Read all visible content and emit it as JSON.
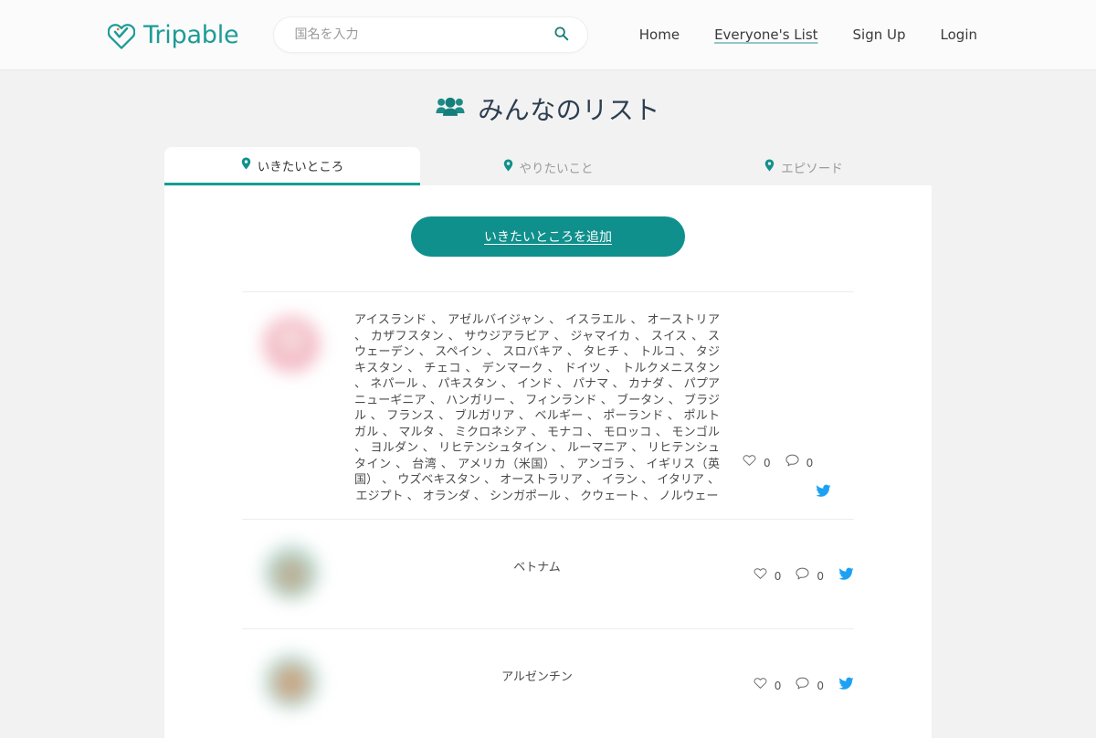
{
  "header": {
    "brand": "Tripable",
    "brand_icon": "heart-check-logo-icon",
    "search": {
      "placeholder": "国名を入力",
      "value": "",
      "icon": "search-icon"
    },
    "nav": [
      {
        "label": "Home",
        "active": false
      },
      {
        "label": "Everyone's List",
        "active": true
      },
      {
        "label": "Sign Up",
        "active": false
      },
      {
        "label": "Login",
        "active": false
      }
    ]
  },
  "page": {
    "title": "みんなのリスト",
    "title_icon": "users-group-icon"
  },
  "tabs": [
    {
      "label": "いきたいところ",
      "icon": "map-pin-icon",
      "active": true
    },
    {
      "label": "やりたいこと",
      "icon": "map-pin-icon",
      "active": false
    },
    {
      "label": "エピソード",
      "icon": "map-pin-icon",
      "active": false
    }
  ],
  "add_button": {
    "label": "いきたいところを追加"
  },
  "entries": [
    {
      "avatar": "blurred-pink-avatar",
      "text": "アイスランド 、 アゼルバイジャン 、 イスラエル 、 オーストリア 、 カザフスタン 、 サウジアラビア 、 ジャマイカ 、 スイス 、 スウェーデン 、 スペイン 、 スロバキア 、 タヒチ 、 トルコ 、 タジキスタン 、 チェコ 、 デンマーク 、 ドイツ 、 トルクメニスタン 、 ネパール 、 パキスタン 、 インド 、 パナマ 、 カナダ 、 パプアニューギニア 、 ハンガリー 、 フィンランド 、 ブータン 、 ブラジル 、 フランス 、 ブルガリア 、 ベルギー 、 ポーランド 、 ポルトガル 、 マルタ 、 ミクロネシア 、 モナコ 、 モロッコ 、 モンゴル 、 ヨルダン 、 リヒテンシュタイン 、 ルーマニア 、 リヒテンシュタイン 、 台湾 、 アメリカ（米国） 、 アンゴラ 、 イギリス（英国） 、 ウズベキスタン 、 オーストラリア 、 イラン 、 イタリア 、 エジプト 、 オランダ 、 シンガポール 、 クウェート 、 ノルウェー",
      "likes": "0",
      "comments": "0",
      "like_icon": "heart-icon",
      "comment_icon": "comment-bubble-icon",
      "share_icon": "twitter-bird-icon",
      "actions_layout": "stacked"
    },
    {
      "avatar": "blurred-teal-avatar",
      "text": "ベトナム",
      "likes": "0",
      "comments": "0",
      "like_icon": "heart-icon",
      "comment_icon": "comment-bubble-icon",
      "share_icon": "twitter-bird-icon",
      "actions_layout": "inline"
    },
    {
      "avatar": "blurred-portrait-avatar",
      "text": "アルゼンチン",
      "likes": "0",
      "comments": "0",
      "like_icon": "heart-icon",
      "comment_icon": "comment-bubble-icon",
      "share_icon": "twitter-bird-icon",
      "actions_layout": "inline"
    }
  ],
  "colors": {
    "brand_teal": "#1d9b96",
    "button_teal": "#10908c",
    "tab_underline": "#159e94",
    "twitter_blue": "#1da1f2",
    "page_bg": "#f2f2f2"
  }
}
